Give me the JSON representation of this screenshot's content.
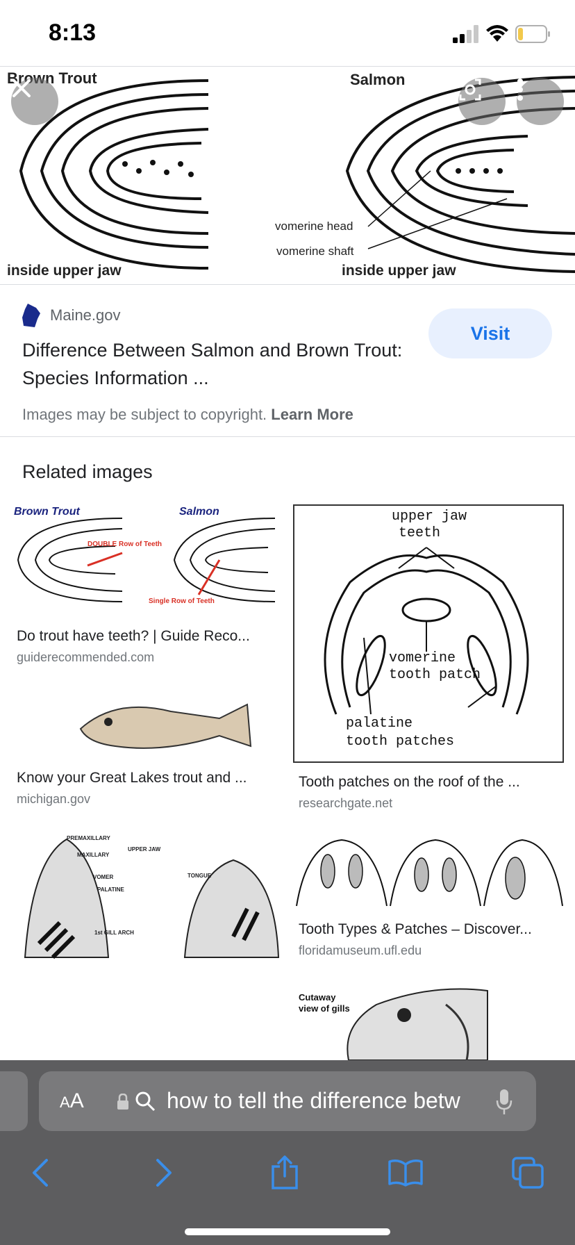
{
  "status": {
    "time": "8:13"
  },
  "hero": {
    "label_left": "Brown Trout",
    "label_right": "Salmon",
    "caption_left": "inside upper jaw",
    "caption_right": "inside upper jaw",
    "anno_head": "vomerine head",
    "anno_shaft": "vomerine shaft"
  },
  "source": {
    "site": "Maine.gov",
    "title": "Difference Between Salmon and Brown Trout: Species Information ...",
    "visit": "Visit",
    "copyright": "Images may be subject to copyright.",
    "learn_more": "Learn More"
  },
  "related": {
    "heading": "Related images",
    "items": [
      {
        "title": "Do trout have teeth? | Guide Reco...",
        "domain": "guiderecommended.com",
        "img_a": "Brown Trout",
        "img_b": "Salmon",
        "img_c": "DOUBLE Row of Teeth",
        "img_d": "Single Row of Teeth"
      },
      {
        "title": "Tooth patches on the roof of the ...",
        "domain": "researchgate.net",
        "img_a": "upper jaw",
        "img_b": "teeth",
        "img_c": "vomerine",
        "img_d": "tooth patch",
        "img_e": "palatine",
        "img_f": "tooth patches"
      },
      {
        "title": "Know your Great Lakes trout and ...",
        "domain": "michigan.gov"
      },
      {
        "title": "Tooth Types & Patches – Discover...",
        "domain": "floridamuseum.ufl.edu"
      },
      {
        "title": "",
        "domain": "",
        "img_a": "PREMAXILLARY",
        "img_b": "MAXILLARY",
        "img_c": "VOMER",
        "img_d": "PALATINE",
        "img_e": "UPPER JAW",
        "img_f": "TONGUE",
        "img_g": "1st GILL ARCH"
      },
      {
        "title": "",
        "domain": "",
        "img_a": "Cutaway",
        "img_b": "view of gills"
      }
    ]
  },
  "browser": {
    "aa_big": "A",
    "aa_small": "A",
    "url": "how to tell the difference betw"
  }
}
